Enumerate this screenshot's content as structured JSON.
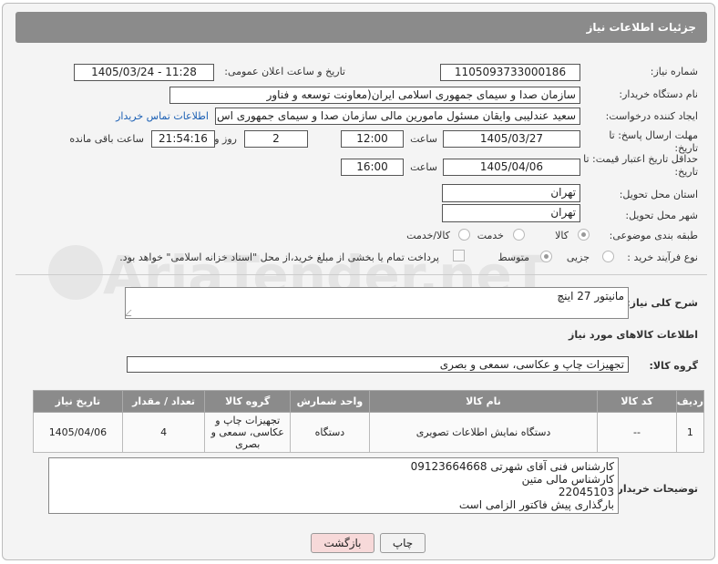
{
  "header": {
    "title": "جزئیات اطلاعات نیاز"
  },
  "need_number": {
    "label": "شماره نیاز:",
    "value": "1105093733000186"
  },
  "announce": {
    "label": "تاریخ و ساعت اعلان عمومی:",
    "value": "1405/03/24 - 11:28"
  },
  "buyer_org": {
    "label": "نام دستگاه خریدار:",
    "value": "سازمان صدا و سیمای جمهوری اسلامی ایران(معاونت توسعه و فناور"
  },
  "creator": {
    "label": "ایجاد کننده درخواست:",
    "value": "سعید عندلیبی وایقان مسئول مامورین مالی  سازمان صدا و سیمای جمهوری اس",
    "contact_link": "اطلاعات تماس خریدار"
  },
  "reply_deadline": {
    "label": "مهلت ارسال پاسخ: تا تاریخ:",
    "date": "1405/03/27",
    "time_label": "ساعت",
    "time": "12:00",
    "days": "2",
    "days_label": "روز و",
    "remaining": "21:54:16",
    "remaining_label": "ساعت باقی مانده"
  },
  "price_validity": {
    "label": "حداقل تاریخ اعتبار قیمت: تا تاریخ:",
    "date": "1405/04/06",
    "time_label": "ساعت",
    "time": "16:00"
  },
  "province": {
    "label": "استان محل تحویل:",
    "value": "تهران"
  },
  "city": {
    "label": "شهر محل تحویل:",
    "value": "تهران"
  },
  "category": {
    "label": "طبقه بندی موضوعی:",
    "options": [
      "کالا",
      "خدمت",
      "کالا/خدمت"
    ],
    "selected": "کالا"
  },
  "process": {
    "label": "نوع فرآیند خرید :",
    "options": [
      "جزیی",
      "متوسط"
    ],
    "selected": "متوسط",
    "note": "پرداخت تمام یا بخشی از مبلغ خرید،از محل \"اسناد خزانه اسلامی\" خواهد بود."
  },
  "need_desc": {
    "label": "شرح کلی نیاز:",
    "value": "مانیتور 27 اینچ"
  },
  "goods_info_title": "اطلاعات کالاهای مورد نیاز",
  "goods_group": {
    "label": "گروه کالا:",
    "value": "تجهیزات چاپ و عکاسی، سمعی و بصری"
  },
  "table": {
    "headers": [
      "ردیف",
      "کد کالا",
      "نام کالا",
      "واحد شمارش",
      "گروه کالا",
      "تعداد / مقدار",
      "تاریخ نیاز"
    ],
    "rows": [
      [
        "1",
        "--",
        "دستگاه نمایش اطلاعات تصویری",
        "دستگاه",
        "تجهیزات چاپ و عکاسی، سمعی و بصری",
        "4",
        "1405/04/06"
      ]
    ]
  },
  "buyer_notes": {
    "label": "توضیحات خریدار:",
    "lines": [
      "کارشناس فنی آقای شهرتی 09123664668",
      "کارشناس مالی متین",
      "22045103",
      "بارگذاری پیش فاکتور الزامی است"
    ]
  },
  "buttons": {
    "print": "چاپ",
    "back": "بازگشت"
  },
  "watermark": "AriaTender.neT",
  "colors": {
    "header_bg": "#8b8b8b",
    "link": "#1a5fb4",
    "back_btn": "#f7d9d9"
  }
}
